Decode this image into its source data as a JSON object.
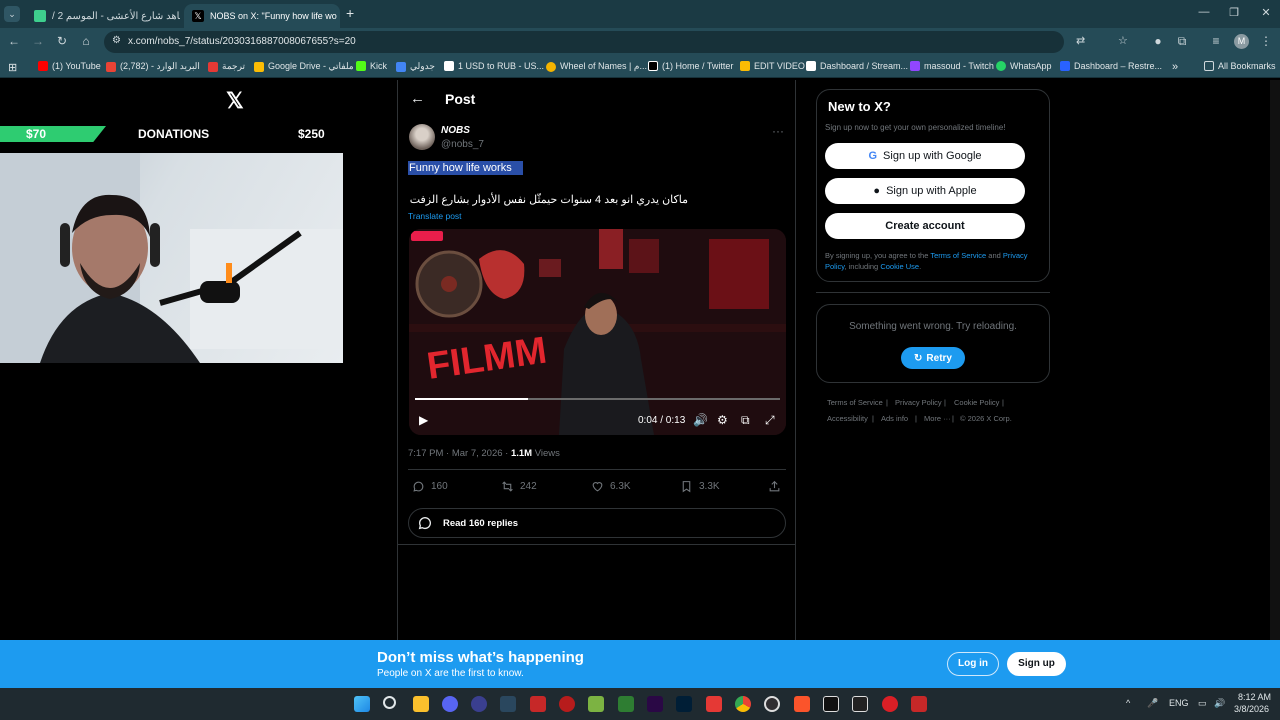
{
  "browser": {
    "tabs": [
      {
        "title": "شاهد شارع الأعشى - الموسم 2 /",
        "active": false
      },
      {
        "title": "NOBS on X: \"Funny how life wo",
        "active": true
      }
    ],
    "new_tab": "+",
    "url": "x.com/nobs_7/status/2030316887008067655?s=20",
    "bookmarks": [
      {
        "label": "(1) YouTube",
        "color": "#ff0000"
      },
      {
        "label": "البريد الوارد - (2,782)",
        "color": "#ea4335"
      },
      {
        "label": "ترجمة",
        "color": "#e53935"
      },
      {
        "label": "Google Drive - ملفاتي",
        "color": "#fbbc04"
      },
      {
        "label": "Kick",
        "color": "#53fc18"
      },
      {
        "label": "جدولي",
        "color": "#4285f4"
      },
      {
        "label": "1 USD to RUB - US...",
        "color": "#ffffff"
      },
      {
        "label": "Wheel of Names | م...",
        "color": "#f4b400"
      },
      {
        "label": "(1) Home / Twitter",
        "color": "#000000"
      },
      {
        "label": "EDIT VIDEO",
        "color": "#fbbc04"
      },
      {
        "label": "Dashboard / Stream...",
        "color": "#ffffff"
      },
      {
        "label": "massoud - Twitch",
        "color": "#9146ff"
      },
      {
        "label": "WhatsApp",
        "color": "#25d366"
      },
      {
        "label": "Dashboard – Restre...",
        "color": "#2962ff"
      }
    ],
    "all_bookmarks": "All Bookmarks",
    "profile_initial": "M"
  },
  "stream_overlay": {
    "donation_current": "$70",
    "donation_label": "DONATIONS",
    "donation_goal": "$250"
  },
  "post": {
    "header": "Post",
    "author_name": "NOBS",
    "author_handle": "@nobs_7",
    "more": "···",
    "highlight_text": "Funny how life works",
    "arabic_text": "ماكان يدري انو بعد 4 سنوات حيمثّل نفس الأدوار بشارع الزفت",
    "translate": "Translate post",
    "video_time": "0:04 / 0:13",
    "video_progress": 0.31,
    "timestamp": "7:17 PM · Mar 7, 2026 · ",
    "views_count": "1.1M",
    "views_label": " Views",
    "replies": "160",
    "reposts": "242",
    "likes": "6.3K",
    "bookmarks": "3.3K",
    "read_replies": "Read 160 replies"
  },
  "sidebar": {
    "new_title": "New to X?",
    "new_sub": "Sign up now to get your own personalized timeline!",
    "google": "Sign up with Google",
    "apple": "Sign up with Apple",
    "create": "Create account",
    "legal_1": "By signing up, you agree to the ",
    "legal_tos": "Terms of Service",
    "legal_2": " and ",
    "legal_privacy": "Privacy Policy",
    "legal_3": ", including ",
    "legal_cookie": "Cookie Use",
    "legal_4": ".",
    "error": "Something went wrong. Try reloading.",
    "retry": "Retry",
    "footer": {
      "tos": "Terms of Service",
      "privacy": "Privacy Policy",
      "cookie": "Cookie Policy",
      "access": "Accessibility",
      "ads": "Ads info",
      "more": "More ···",
      "copy": "© 2026 X Corp."
    }
  },
  "banner": {
    "title": "Don’t miss what’s happening",
    "sub": "People on X are the first to know.",
    "login": "Log in",
    "signup": "Sign up"
  },
  "taskbar": {
    "lang": "ENG",
    "time": "8:12 AM",
    "date": "3/8/2026"
  }
}
